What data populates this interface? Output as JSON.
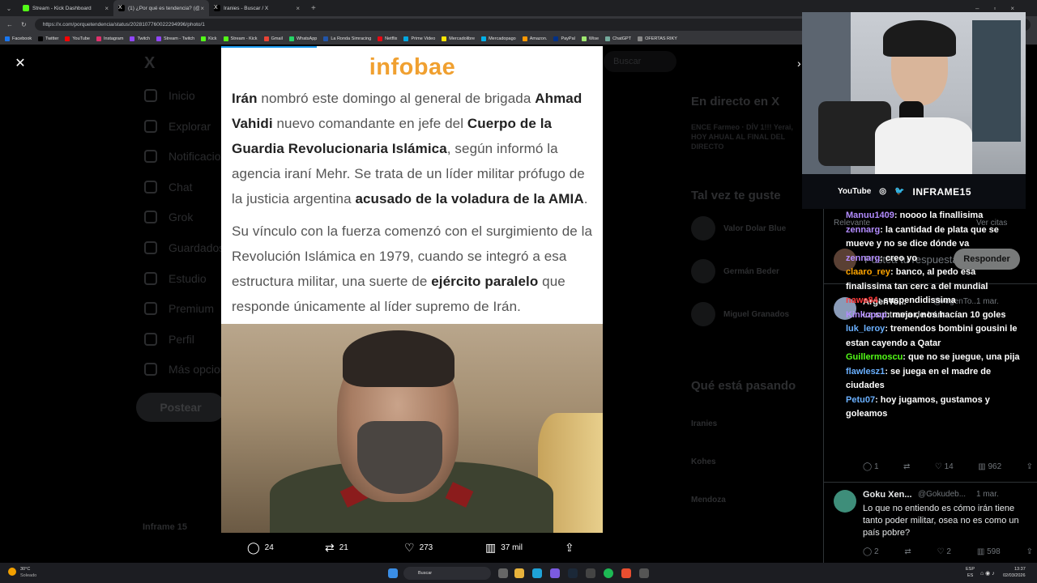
{
  "browser": {
    "tabs": [
      {
        "title": "Stream - Kick Dashboard",
        "color": "#53fc18"
      },
      {
        "title": "(1) ¿Por qué es tendencia? (@porq",
        "color": "#ffffff"
      },
      {
        "title": "Iranies - Buscar / X",
        "color": "#ffffff"
      }
    ],
    "url": "https://x.com/porquetendencia/status/2028107760022294996/photo/1",
    "bookmarks": [
      "Facebook",
      "Twitter",
      "YouTube",
      "Instagram",
      "Twitch",
      "Stream - Twitch",
      "Kick",
      "Stream - Kick",
      "Gmail",
      "WhatsApp",
      "La Ronda Simracing",
      "Netflix",
      "Prime Video",
      "Mercadolibre",
      "Mercadopago",
      "Amazon.",
      "PayPal",
      "Wise",
      "ChatGPT",
      "OFERTAS RIKY"
    ]
  },
  "background": {
    "nav": [
      "Inicio",
      "Explorar",
      "Notificaciones",
      "Chat",
      "Grok",
      "Guardados",
      "Estudio",
      "Premium",
      "Perfil",
      "Más opciones"
    ],
    "post_button": "Postear",
    "search": "Buscar",
    "live_title": "En directo en X",
    "live_item": "ENCE Farmeo · DÍV 1!!! Yerai, HOY AHUAL AL FINAL DEL DIRECTO",
    "suggest_title": "Tal vez te guste",
    "suggestions": [
      "Valor Dolar Blue",
      "Germán Beder",
      "Miguel Granados"
    ],
    "trending_title": "Qué está pasando",
    "trends": [
      "Iranies",
      "Kohes",
      "Mendoza"
    ],
    "profile": "Inframe 15",
    "relevant": "Relevante",
    "see_quotes": "Ver citas",
    "reply_placeholder": "Postea tu respuesta",
    "reply_button": "Responder"
  },
  "article": {
    "logo": "infobae",
    "p1_a": "Irán",
    "p1_b": " nombró este domingo al general de brigada ",
    "p1_c": "Ahmad Vahidi",
    "p1_d": " nuevo comandante en jefe del ",
    "p1_e": "Cuerpo de la Guardia Revolucionaria Islámica",
    "p1_f": ", según informó la agencia iraní Mehr. Se trata de un líder militar prófugo de la justicia argentina ",
    "p1_g": "acusado de la voladura de la AMIA",
    "p1_h": ".",
    "p2_a": "Su vínculo con la fuerza comenzó con el surgimiento de la Revolución Islámica en 1979, cuando se integró a esa estructura militar, una suerte de ",
    "p2_b": "ejército paralelo",
    "p2_c": " que responde únicamente al líder supremo de Irán."
  },
  "actions": {
    "replies": "24",
    "reposts": "21",
    "likes": "273",
    "views": "37 mil"
  },
  "webcam": {
    "channel": "INFRAME15",
    "youtube": "YouTube"
  },
  "chat": [
    {
      "user": "Manuu1409",
      "color": "#b38cff",
      "text": ": noooo la finallisima"
    },
    {
      "user": "zennarg",
      "color": "#b38cff",
      "text": ": la cantidad de plata que se mueve y no se dice dónde va"
    },
    {
      "user": "zennarg",
      "color": "#b38cff",
      "text": ": creo yo"
    },
    {
      "user": "claaro_rey",
      "color": "#ffa500",
      "text": ": banco, al pedo esa finalissima tan cerc a del mundial"
    },
    {
      "user": "nawe84",
      "color": "#ff3b3b",
      "text": ": suspendidissima"
    },
    {
      "user": "Kinkopop",
      "color": "#b38cff",
      "text": ": mejor, nos hacían 10 goles"
    },
    {
      "user": "luk_leroy",
      "color": "#6ab0ff",
      "text": ": tremendos bombini gousini le estan cayendo a Qatar"
    },
    {
      "user": "Guillermoscu",
      "color": "#53fc18",
      "text": ": que no se juegue, una pija"
    },
    {
      "user": "flawlesz1",
      "color": "#6ab0ff",
      "text": ": se juega en el madre de ciudades"
    },
    {
      "user": "Petu07",
      "color": "#6ab0ff",
      "text": ": hoy jugamos, gustamos y goleamos"
    }
  ],
  "tweets": [
    {
      "name": "ArgenTo...",
      "handle": "@ArgenTo...",
      "date": "1 mar.",
      "text": "La subtrama de Irán:",
      "replies": "1",
      "likes": "14",
      "views": "962"
    },
    {
      "name": "Goku Xen...",
      "handle": "@Gokudeb...",
      "date": "1 mar.",
      "text": "Lo que no entiendo es cómo irán tiene tanto poder militar, osea no es como un país pobre?",
      "replies": "2",
      "likes": "2",
      "views": "598"
    }
  ],
  "taskbar": {
    "weather_temp": "30°C",
    "weather_desc": "Soleado",
    "search": "Buscar",
    "lang": "ESP",
    "lang2": "ES",
    "time": "13:37",
    "date": "02/03/2026"
  }
}
